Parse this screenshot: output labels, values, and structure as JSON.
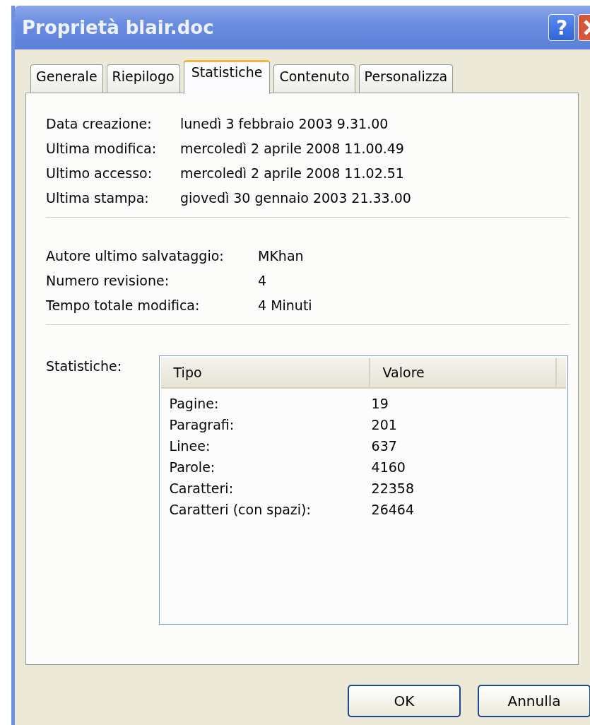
{
  "window": {
    "title": "Proprietà blair.doc",
    "help_button": "?"
  },
  "tabs": [
    {
      "label": "Generale",
      "selected": false
    },
    {
      "label": "Riepilogo",
      "selected": false
    },
    {
      "label": "Statistiche",
      "selected": true
    },
    {
      "label": "Contenuto",
      "selected": false
    },
    {
      "label": "Personalizza",
      "selected": false
    }
  ],
  "dates": [
    {
      "label": "Data creazione:",
      "value": "lunedì 3 febbraio 2003 9.31.00"
    },
    {
      "label": "Ultima modifica:",
      "value": "mercoledì 2 aprile 2008 11.00.49"
    },
    {
      "label": "Ultimo accesso:",
      "value": "mercoledì 2 aprile 2008 11.02.51"
    },
    {
      "label": "Ultima stampa:",
      "value": "giovedì 30 gennaio 2003 21.33.00"
    }
  ],
  "details": [
    {
      "label": "Autore ultimo salvataggio:",
      "value": "MKhan"
    },
    {
      "label": "Numero revisione:",
      "value": "4"
    },
    {
      "label": "Tempo totale modifica:",
      "value": "4 Minuti"
    }
  ],
  "statistics": {
    "label": "Statistiche:",
    "columns": [
      "Tipo",
      "Valore"
    ],
    "rows": [
      [
        "Pagine:",
        "19"
      ],
      [
        "Paragrafi:",
        "201"
      ],
      [
        "Linee:",
        "637"
      ],
      [
        "Parole:",
        "4160"
      ],
      [
        "Caratteri:",
        "22358"
      ],
      [
        "Caratteri (con spazi):",
        "26464"
      ]
    ]
  },
  "buttons": [
    "OK",
    "Annulla"
  ]
}
